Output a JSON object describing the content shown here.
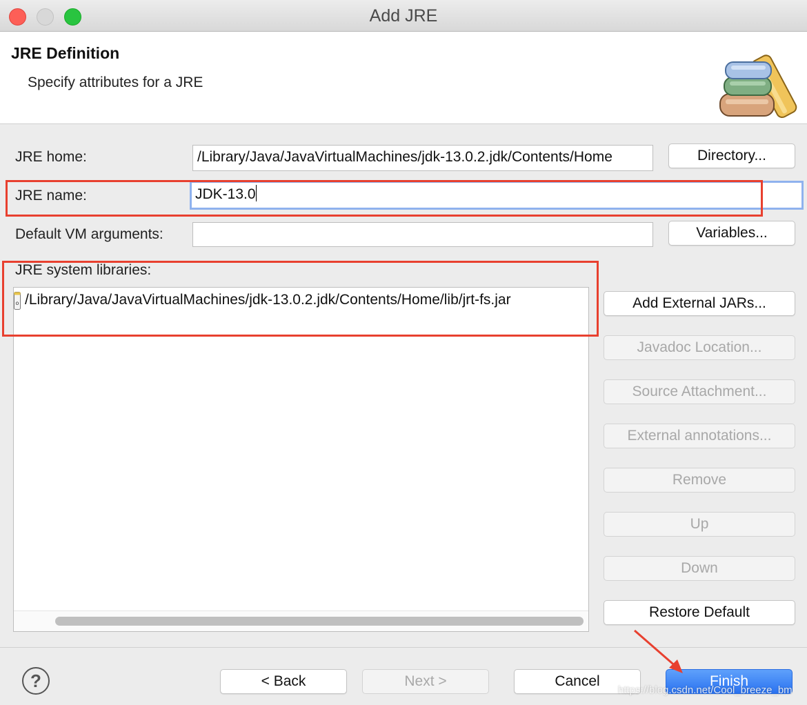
{
  "window": {
    "title": "Add JRE"
  },
  "header": {
    "title": "JRE Definition",
    "description": "Specify attributes for a JRE",
    "image_icon": "books-library-icon"
  },
  "form": {
    "jre_home_label": "JRE home:",
    "jre_home_value": "/Library/Java/JavaVirtualMachines/jdk-13.0.2.jdk/Contents/Home",
    "jre_name_label": "JRE name:",
    "jre_name_value": "JDK-13.0",
    "vm_args_label": "Default VM arguments:",
    "vm_args_value": "",
    "libraries_label": "JRE system libraries:"
  },
  "libraries": [
    {
      "path": "/Library/Java/JavaVirtualMachines/jdk-13.0.2.jdk/Contents/Home/lib/jrt-fs.jar",
      "icon": "jar-file-icon"
    }
  ],
  "buttons": {
    "directory": "Directory...",
    "variables": "Variables...",
    "add_external_jars": "Add External JARs...",
    "javadoc_location": "Javadoc Location...",
    "source_attachment": "Source Attachment...",
    "external_annotations": "External annotations...",
    "remove": "Remove",
    "up": "Up",
    "down": "Down",
    "restore_default": "Restore Default",
    "back": "< Back",
    "next": "Next >",
    "cancel": "Cancel",
    "finish": "Finish",
    "help": "?"
  },
  "watermark": "https://blog.csdn.net/Cool_breeze_bm",
  "colors": {
    "annotation_red": "#e8402f",
    "focus_blue": "#8fb2ee",
    "primary_blue": "#2a72f0"
  }
}
